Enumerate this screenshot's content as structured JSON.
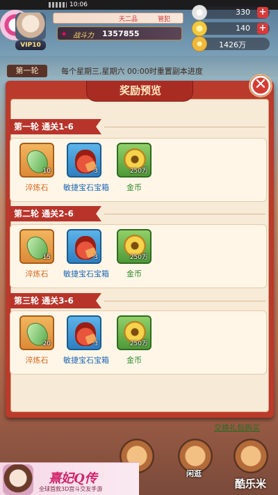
{
  "status_bar": {
    "time": "10:06"
  },
  "player": {
    "vip": "VIP10",
    "guild": "天二品",
    "title": "管犯",
    "power_label": "战斗力",
    "power_value": "1357855"
  },
  "currencies": [
    {
      "name": "silver",
      "value": "330",
      "icon": "silver-ingot-icon"
    },
    {
      "name": "gold-ingot",
      "value": "140",
      "icon": "gold-ingot-icon"
    },
    {
      "name": "coins",
      "value": "1426万",
      "icon": "gold-coin-icon"
    }
  ],
  "background": {
    "round_tag": "第一轮",
    "notice": "每个星期三,星期六 00:00时重置副本进度"
  },
  "modal": {
    "title": "奖励预览",
    "close": "✕",
    "rounds": [
      {
        "header": "第一轮  通关1-6",
        "items": [
          {
            "name": "淬炼石",
            "qty": "10",
            "color": "orange",
            "icon": "jade-stone-icon"
          },
          {
            "name": "敏捷宝石宝箱",
            "qty": "3",
            "color": "blue",
            "icon": "gem-bag-icon"
          },
          {
            "name": "金币",
            "qty": "250万",
            "color": "green",
            "icon": "gold-coin-icon"
          }
        ]
      },
      {
        "header": "第二轮  通关2-6",
        "items": [
          {
            "name": "淬炼石",
            "qty": "15",
            "color": "orange",
            "icon": "jade-stone-icon"
          },
          {
            "name": "敏捷宝石宝箱",
            "qty": "3",
            "color": "blue",
            "icon": "gem-bag-icon"
          },
          {
            "name": "金币",
            "qty": "250万",
            "color": "green",
            "icon": "gold-coin-icon"
          }
        ]
      },
      {
        "header": "第三轮  通关3-6",
        "items": [
          {
            "name": "淬炼石",
            "qty": "20",
            "color": "orange",
            "icon": "jade-stone-icon"
          },
          {
            "name": "敏捷宝石宝箱",
            "qty": "3",
            "color": "blue",
            "icon": "gem-bag-icon"
          },
          {
            "name": "金币",
            "qty": "250万",
            "color": "green",
            "icon": "gold-coin-icon"
          }
        ]
      }
    ]
  },
  "footer": {
    "exchange_link": "交换礼包购买",
    "menu_label": "闲逛",
    "ad_title": "熹妃Q传",
    "ad_sub": "全球首款3D宫斗交友手游",
    "watermark": "酷乐米"
  }
}
